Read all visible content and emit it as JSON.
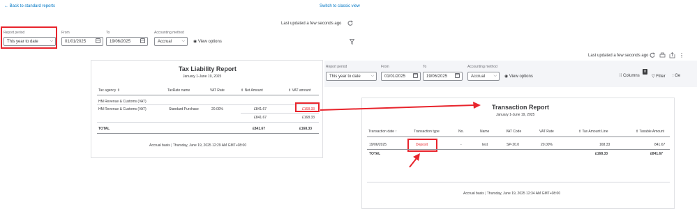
{
  "left_panel": {
    "back_link": "Back to standard reports",
    "switch_link": "Switch to classic view",
    "last_updated": "Last updated a few seconds ago",
    "report_period_label": "Report period",
    "report_period_value": "This year to date",
    "from_label": "From",
    "from_value": "01/01/2025",
    "to_label": "To",
    "to_value": "19/06/2025",
    "accounting_method_label": "Accounting method",
    "accounting_method_value": "Accrual",
    "view_options": "View options"
  },
  "tax_report": {
    "title": "Tax Liability Report",
    "subtitle": "January 1-June 19, 2025",
    "columns": [
      "Tax agency",
      "TaxRate name",
      "VAT Rate",
      "Net Amount",
      "VAT amount"
    ],
    "group_name": "HM Revenue & Customs (VAT)",
    "row": {
      "agency": "HM Revenue & Customs (VAT)",
      "rate_name": "Standard Purchase",
      "rate": "20.00%",
      "net": "£841.67",
      "vat": "£168.33"
    },
    "subtotal": {
      "net": "£841.67",
      "vat": "£168.33"
    },
    "total": {
      "label": "TOTAL",
      "net": "£841.67",
      "vat": "£168.33"
    },
    "footer_basis": "Accrual basis",
    "footer_date": "Thursday, June 19, 2025 12:29 AM GMT+08:00"
  },
  "right_panel": {
    "last_updated": "Last updated a few seconds ago",
    "report_period_label": "Report period",
    "report_period_value": "This year to date",
    "from_label": "From",
    "from_value": "01/01/2025",
    "to_label": "To",
    "to_value": "19/06/2025",
    "accounting_method_label": "Accounting method",
    "accounting_method_value": "Accrual",
    "view_options": "View options",
    "columns_label": "Columns",
    "columns_badge": "8",
    "filter_label": "Filter",
    "general_label": "Ge"
  },
  "txn_report": {
    "title": "Transaction Report",
    "subtitle": "January 1-June 19, 2025",
    "columns": [
      "Transaction date",
      "Transaction type",
      "No.",
      "Name",
      "VAT Code",
      "VAT Rate",
      "Tax Amount Line",
      "Taxable Amount"
    ],
    "row": {
      "date": "19/06/2025",
      "type": "Deposit",
      "no": "-",
      "name": "test",
      "code": "SP-20.0",
      "rate": "20.00%",
      "tax": "168.33",
      "taxable": "841.67"
    },
    "total": {
      "label": "TOTAL",
      "tax": "£168.33",
      "taxable": "£841.67"
    },
    "footer_basis": "Accrual basis",
    "footer_date": "Thursday, June 19, 2025 12:34 AM GMT+08:00"
  },
  "colors": {
    "accent_link": "#0077c5",
    "highlight_red": "#e8242c",
    "text": "#393a3d"
  }
}
